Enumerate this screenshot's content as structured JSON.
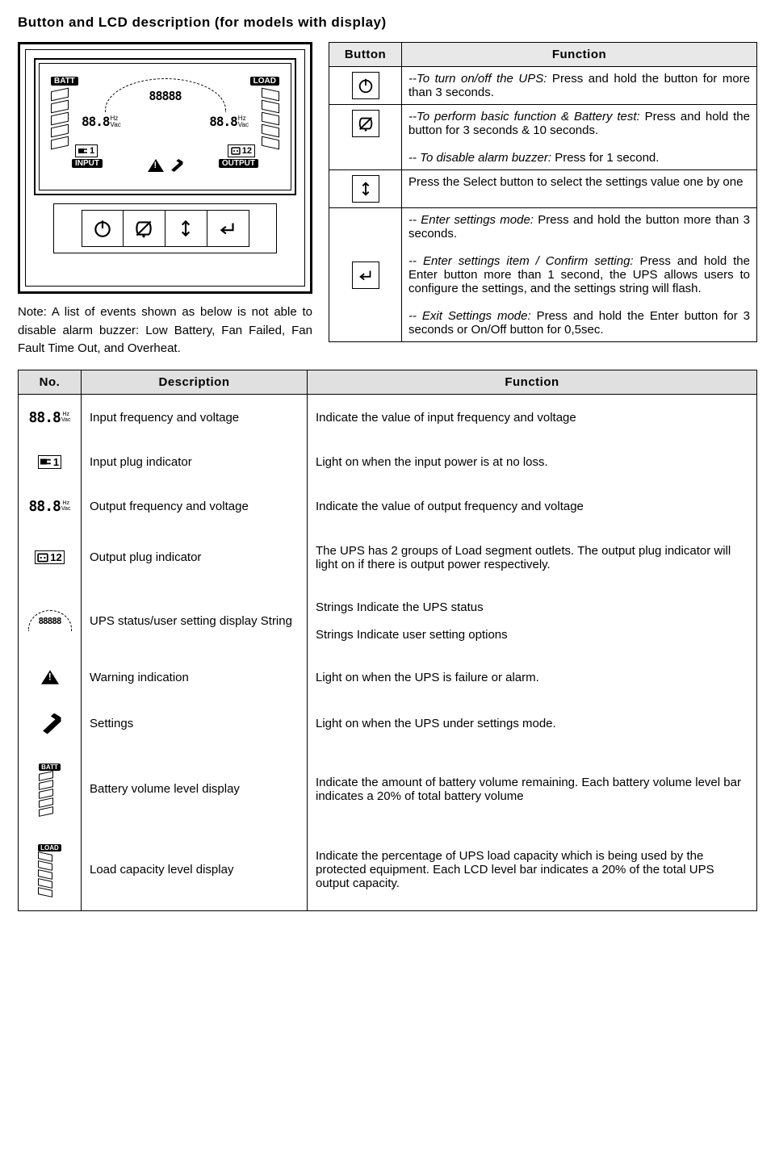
{
  "title": "Button and LCD description (for models with display)",
  "lcd": {
    "batt": "BATT",
    "load": "LOAD",
    "status_string": "88888",
    "hzvac": "88.8",
    "hz": "Hz",
    "vac": "Vac",
    "input_plug": "1",
    "output_plug": "12",
    "input": "INPUT",
    "output": "OUTPUT"
  },
  "note": "Note: A list of events shown as below is not able to disable alarm buzzer: Low Battery, Fan Failed, Fan Fault Time Out, and Overheat.",
  "button_table": {
    "headers": {
      "button": "Button",
      "function": "Function"
    },
    "rows": [
      {
        "icon": "power-icon",
        "html": "<i>--To turn on/off the UPS:</i>  Press and hold the button  for more than 3 seconds."
      },
      {
        "icon": "mute-icon",
        "html": "<i>--To perform basic function & Battery test:</i> Press and hold the button for 3 seconds & 10 seconds.<br><br><i>-- To disable alarm buzzer:</i> Press for 1 second."
      },
      {
        "icon": "select-icon",
        "html": "Press the Select button   to select the settings value one by one"
      },
      {
        "icon": "enter-icon",
        "html": "<i>-- Enter settings mode:</i> Press and hold the button more than 3 seconds.<br><br><i>-- Enter settings item / Confirm setting:</i> Press and hold the Enter button more than 1 second, the UPS allows users to configure the settings, and the settings string  will flash.<br><br><i>-- Exit Settings mode:</i> Press and hold the Enter button for 3 seconds or On/Off button for  0,5sec."
      }
    ]
  },
  "desc_table": {
    "headers": {
      "no": "No.",
      "desc": "Description",
      "func": "Function"
    },
    "rows": [
      {
        "icon": "hzvac-icon",
        "desc": "Input frequency and voltage",
        "func": "Indicate the value of input frequency and voltage"
      },
      {
        "icon": "input-plug-icon",
        "desc": "Input plug indicator",
        "func": "Light on when the input power is at no loss."
      },
      {
        "icon": "hzvac-icon",
        "desc": "Output frequency and voltage",
        "func": "Indicate the value of output frequency and voltage"
      },
      {
        "icon": "output-plug-icon",
        "desc": "Output plug indicator",
        "func": "The UPS has 2 groups of Load segment outlets. The output plug indicator will light on if there is output power respectively."
      },
      {
        "icon": "status-string-icon",
        "desc": "UPS status/user setting display String",
        "func": "Strings Indicate the UPS status<br><br>Strings Indicate user setting options"
      },
      {
        "icon": "warning-icon",
        "desc": "Warning indication",
        "func": "Light on when the UPS is failure or alarm."
      },
      {
        "icon": "wrench-icon",
        "desc": "Settings",
        "func": "Light on when the UPS under settings mode."
      },
      {
        "icon": "batt-level-icon",
        "desc": "Battery volume level display",
        "func": "Indicate the amount of battery volume remaining. Each battery volume level bar indicates a 20% of total battery volume"
      },
      {
        "icon": "load-level-icon",
        "desc": "Load capacity level display",
        "func": "Indicate the percentage of UPS load capacity which is being used by the protected equipment. Each LCD level bar indicates a 20% of the total UPS output capacity."
      }
    ]
  }
}
